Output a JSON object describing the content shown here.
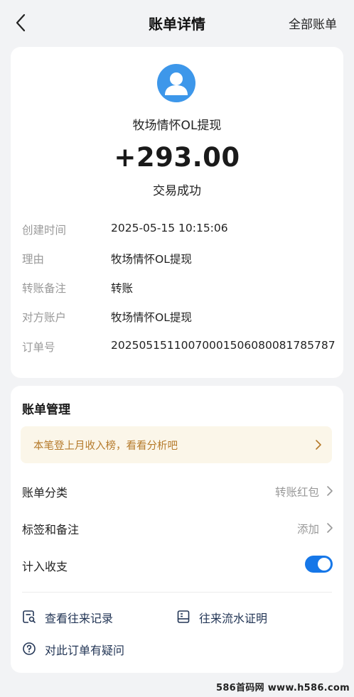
{
  "header": {
    "title": "账单详情",
    "right_action": "全部账单"
  },
  "transaction": {
    "payee": "牧场情怀OL提现",
    "amount": "+293.00",
    "status": "交易成功",
    "details": [
      {
        "label": "创建时间",
        "value": "2025-05-15 10:15:06"
      },
      {
        "label": "理由",
        "value": "牧场情怀OL提现"
      },
      {
        "label": "转账备注",
        "value": "转账"
      },
      {
        "label": "对方账户",
        "value": "牧场情怀OL提现"
      },
      {
        "label": "订单号",
        "value": "2025051511007000150608008178578​7"
      }
    ]
  },
  "management": {
    "title": "账单管理",
    "promo_text": "本笔登上月收入榜，看看分析吧",
    "category_label": "账单分类",
    "category_value": "转账红包",
    "tags_label": "标签和备注",
    "tags_value": "添加",
    "income_label": "计入收支",
    "income_enabled": true,
    "link_history": "查看往来记录",
    "link_proof": "往来流水证明",
    "link_question": "对此订单有疑问"
  },
  "watermark": "586首码网 www.h586.com",
  "colors": {
    "accent": "#1677e8",
    "avatar_bg": "#3d97ea",
    "promo_bg": "#fbf6e9",
    "promo_text": "#b57a2a",
    "link_text": "#233656"
  },
  "icons": {
    "back": "chevron-left-icon",
    "avatar": "user-avatar-icon",
    "history": "search-document-icon",
    "proof": "certificate-icon",
    "question": "question-circle-icon",
    "arrow": "chevron-right-icon"
  }
}
